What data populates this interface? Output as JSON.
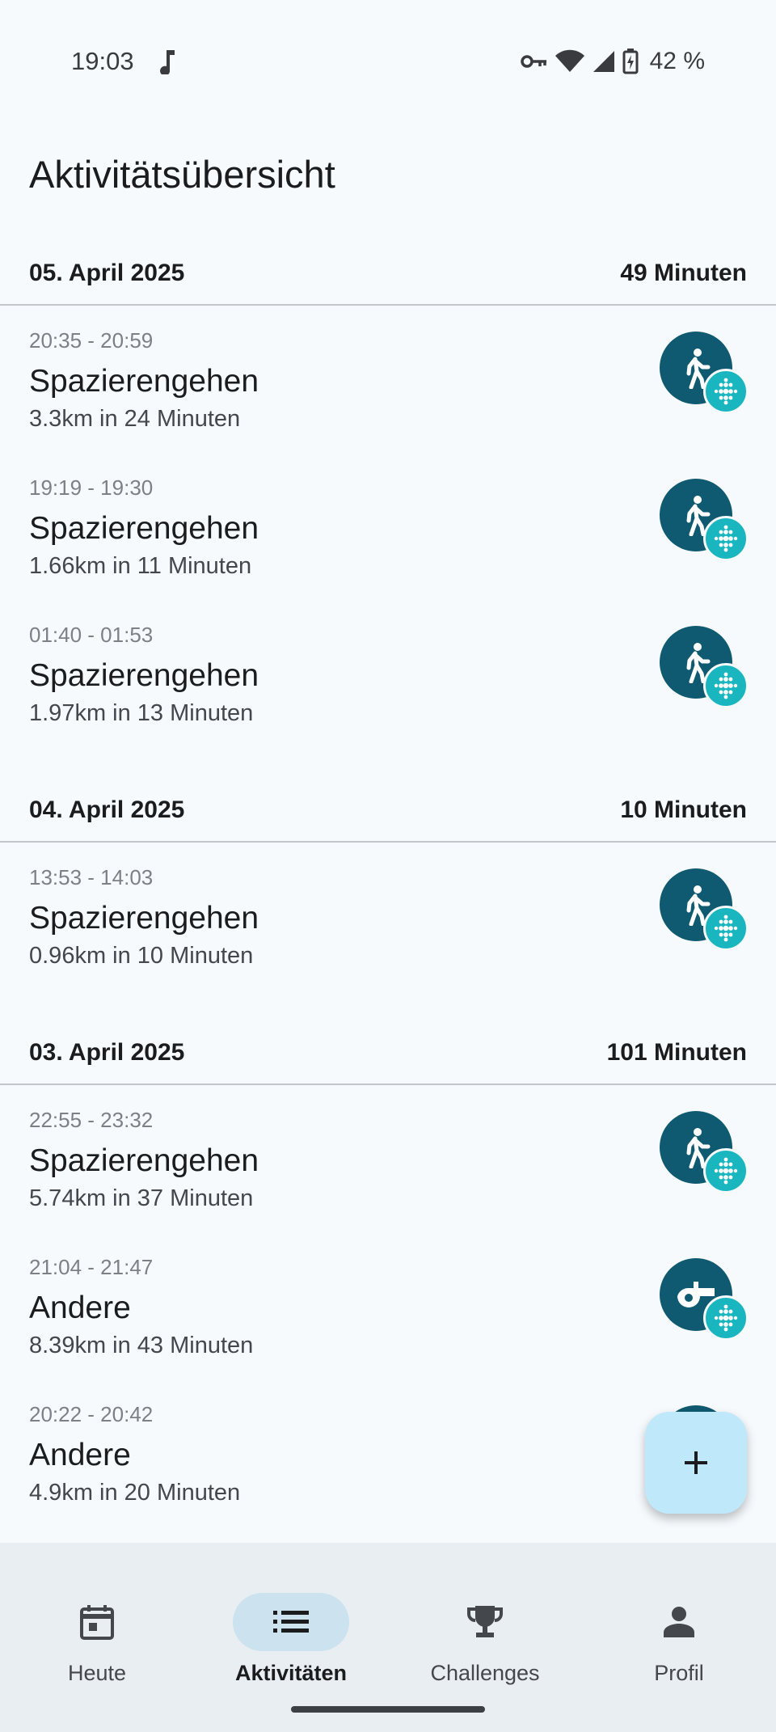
{
  "status": {
    "time": "19:03",
    "battery": "42 %"
  },
  "title": "Aktivitätsübersicht",
  "days": [
    {
      "date": "05. April 2025",
      "total": "49 Minuten",
      "activities": [
        {
          "time": "20:35 - 20:59",
          "name": "Spazierengehen",
          "detail": "3.3km in 24 Minuten",
          "icon": "walking-icon"
        },
        {
          "time": "19:19 - 19:30",
          "name": "Spazierengehen",
          "detail": "1.66km in 11 Minuten",
          "icon": "walking-icon"
        },
        {
          "time": "01:40 - 01:53",
          "name": "Spazierengehen",
          "detail": "1.97km in 13 Minuten",
          "icon": "walking-icon"
        }
      ]
    },
    {
      "date": "04. April 2025",
      "total": "10 Minuten",
      "activities": [
        {
          "time": "13:53 - 14:03",
          "name": "Spazierengehen",
          "detail": "0.96km in 10 Minuten",
          "icon": "walking-icon"
        }
      ]
    },
    {
      "date": "03. April 2025",
      "total": "101 Minuten",
      "activities": [
        {
          "time": "22:55 - 23:32",
          "name": "Spazierengehen",
          "detail": "5.74km in 37 Minuten",
          "icon": "walking-icon"
        },
        {
          "time": "21:04 - 21:47",
          "name": "Andere",
          "detail": "8.39km in 43 Minuten",
          "icon": "whistle-icon"
        },
        {
          "time": "20:22 - 20:42",
          "name": "Andere",
          "detail": "4.9km in 20 Minuten",
          "icon": "whistle-icon"
        }
      ]
    }
  ],
  "nav": [
    {
      "label": "Heute",
      "icon": "calendar-icon",
      "active": false
    },
    {
      "label": "Aktivitäten",
      "icon": "list-icon",
      "active": true
    },
    {
      "label": "Challenges",
      "icon": "trophy-icon",
      "active": false
    },
    {
      "label": "Profil",
      "icon": "person-icon",
      "active": false
    }
  ],
  "colors": {
    "icon_bg": "#0f5a70",
    "badge_bg": "#1ab6c0",
    "fab_bg": "#bfe8fb",
    "nav_active": "#cce3ef"
  }
}
